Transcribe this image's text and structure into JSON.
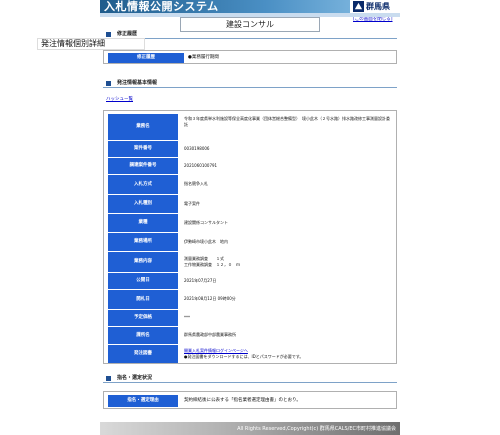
{
  "header": {
    "title": "入札情報公開システム",
    "logo_text": "群馬県",
    "back_link": "[この画面を閉じる]",
    "department": "建設コンサル"
  },
  "overlay_title": "発注情報個別詳細",
  "amendment": {
    "section_title": "修正履歴",
    "label": "修正履歴",
    "value": "●業務履行期間"
  },
  "basic_info": {
    "section_title": "発注情報基本情報",
    "print_link": "ハッシュー覧",
    "rows": [
      {
        "label": "業務名",
        "value": "令和３年度県単水利施設等保全高度化事業（団体営総合整備型）　境小此木（２号水路）排水路改修工事測量設計委託"
      },
      {
        "label": "案件番号",
        "value": "0030198006"
      },
      {
        "label": "調達案件番号",
        "value": "2021060100791"
      },
      {
        "label": "入札方式",
        "value": "指名競争入札"
      },
      {
        "label": "入札種別",
        "value": "電子案件"
      },
      {
        "label": "業種",
        "value": "建設関係コンサルタント"
      },
      {
        "label": "業務場所",
        "value": "伊勢崎市境小此木　地内"
      },
      {
        "label": "業務内容",
        "line1": "測量業務調査　　１式",
        "line2": "工作物業務調査　１２，０　ｍ"
      },
      {
        "label": "公開日",
        "value": "2021年07月27日"
      },
      {
        "label": "開札日",
        "value": "2021年08月12日 09時00分"
      },
      {
        "label": "予定価格",
        "value": "***"
      },
      {
        "label": "課所名",
        "value": "群馬県農政部中部農業事務所"
      },
      {
        "label": "発注図書",
        "link": "開業入札案件情報ログインページへ",
        "note": "●発注図書をダウンロードするには、IDとパスワードが必要です。"
      }
    ]
  },
  "nomination": {
    "section_title": "指名・選定状況",
    "label": "指名・選定理由",
    "value": "契約締結後に公表する「指名業者選定理由書」のとおり。"
  },
  "footer": {
    "copyright": "All Rights Reserved,Copyright(c) 群馬県CALS/EC市町村推進協議会"
  },
  "colors": {
    "label_bg": "#1f5fd4",
    "header_bg": "#1f5c8c",
    "link": "#0000cc"
  }
}
